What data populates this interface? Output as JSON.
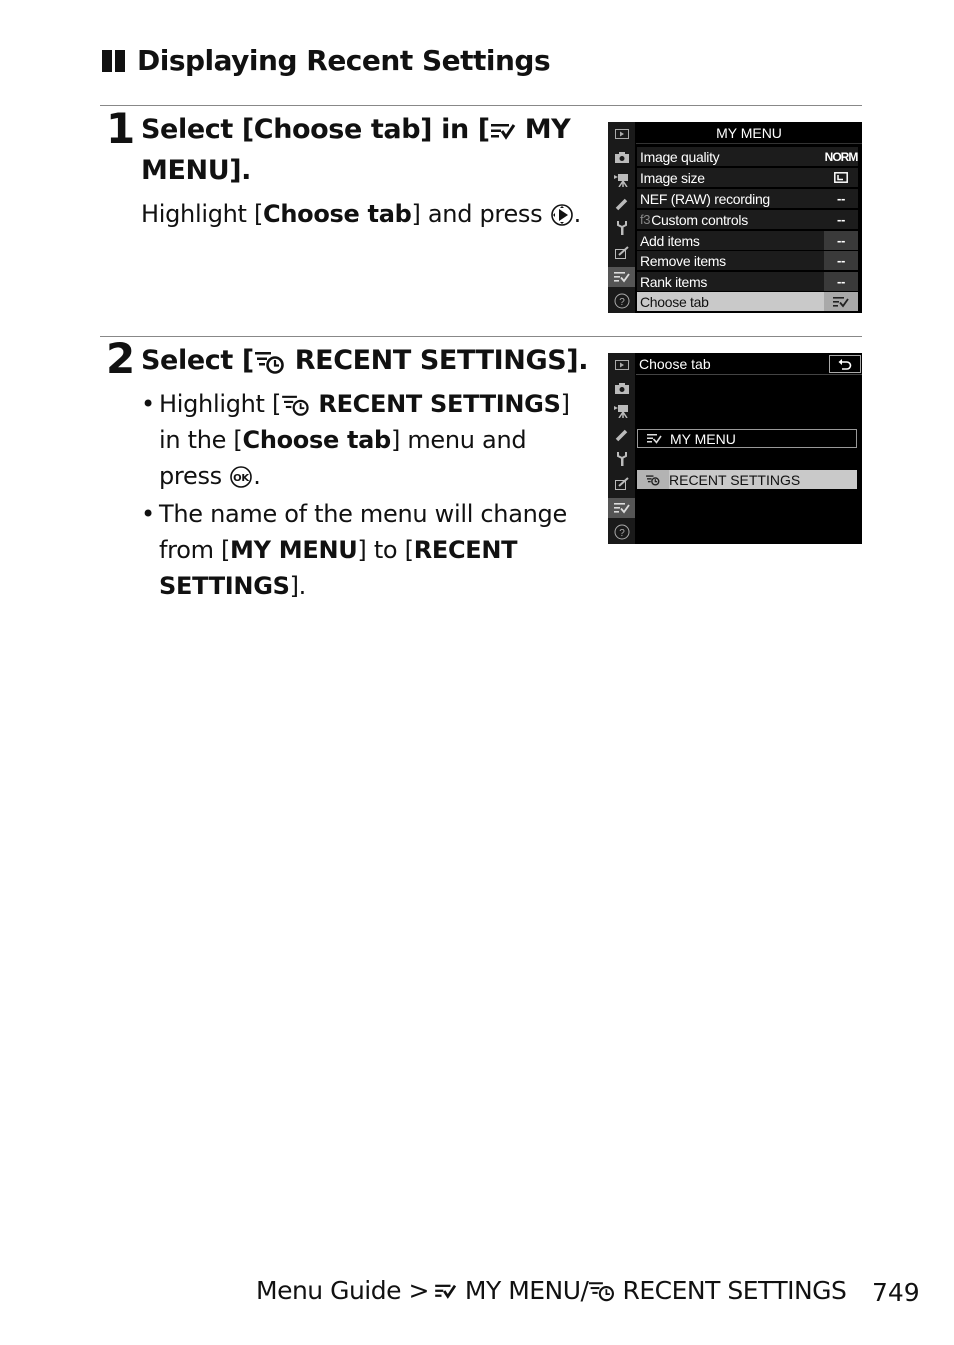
{
  "section": {
    "title": "Displaying Recent Settings"
  },
  "steps": [
    {
      "number": "1",
      "title_pre": "Select [Choose tab] in [",
      "title_post": " MY MENU].",
      "title_icon": "my-menu-icon",
      "body": {
        "pre": "Highlight [",
        "bold": "Choose tab",
        "post": "] and press ",
        "button_icon": "multi-selector-right-icon",
        "end": "."
      },
      "screen": {
        "title": "MY MENU",
        "sidebar": [
          "playback-icon",
          "camera-icon",
          "movie-icon",
          "pencil-icon",
          "wrench-icon",
          "retouch-icon",
          "my-menu-icon",
          "help-icon"
        ],
        "active_sidebar": 6,
        "rows": [
          {
            "label": "Image quality",
            "value": "NORM",
            "style": "normal"
          },
          {
            "label": "Image size",
            "value": "L",
            "value_icon": "image-size-large-icon",
            "style": "normal"
          },
          {
            "label": "NEF (RAW) recording",
            "value": "--",
            "style": "normal"
          },
          {
            "label": "Custom controls",
            "prefix": "f3",
            "value": "--",
            "style": "normal"
          },
          {
            "label": "Add items",
            "value": "--",
            "style": "dim"
          },
          {
            "label": "Remove items",
            "value": "--",
            "style": "dim"
          },
          {
            "label": "Rank items",
            "value": "--",
            "style": "dim"
          },
          {
            "label": "Choose tab",
            "value_icon": "my-menu-icon",
            "style": "highlight"
          }
        ]
      }
    },
    {
      "number": "2",
      "title_pre": "Select [",
      "title_icon": "recent-settings-icon",
      "title_post": " RECENT SETTINGS].",
      "bullets": [
        {
          "pre": "Highlight [",
          "icon": "recent-settings-icon",
          "bold": "RECENT SETTINGS",
          "mid": "] in the [",
          "bold2": "Choose tab",
          "post": "] menu and press ",
          "button_icon": "ok-button-icon",
          "end": "."
        },
        {
          "pre": "The name of the menu will change from [",
          "bold": "MY MENU",
          "mid": "] to [",
          "bold2": "RECENT SETTINGS",
          "post": "]."
        }
      ],
      "screen": {
        "title": "Choose tab",
        "back_icon": "back-icon",
        "sidebar": [
          "playback-icon",
          "camera-icon",
          "movie-icon",
          "pencil-icon",
          "wrench-icon",
          "retouch-icon",
          "my-menu-icon",
          "help-icon"
        ],
        "active_sidebar": 6,
        "options": [
          {
            "label": "MY MENU",
            "icon": "my-menu-icon",
            "selected": false
          },
          {
            "label": "RECENT SETTINGS",
            "icon": "recent-settings-icon",
            "selected": true
          }
        ]
      }
    }
  ],
  "footer": {
    "breadcrumb_pre": "Menu Guide > ",
    "menu1": "MY MENU/",
    "menu2": "RECENT SETTINGS",
    "page": "749"
  },
  "colors": {
    "screen_bg": "#000000",
    "screen_sidebar": "#1a1a1a",
    "row_bg": "#1c1c1c",
    "highlight_bg": "#c9c9c9",
    "rule": "#888888"
  }
}
